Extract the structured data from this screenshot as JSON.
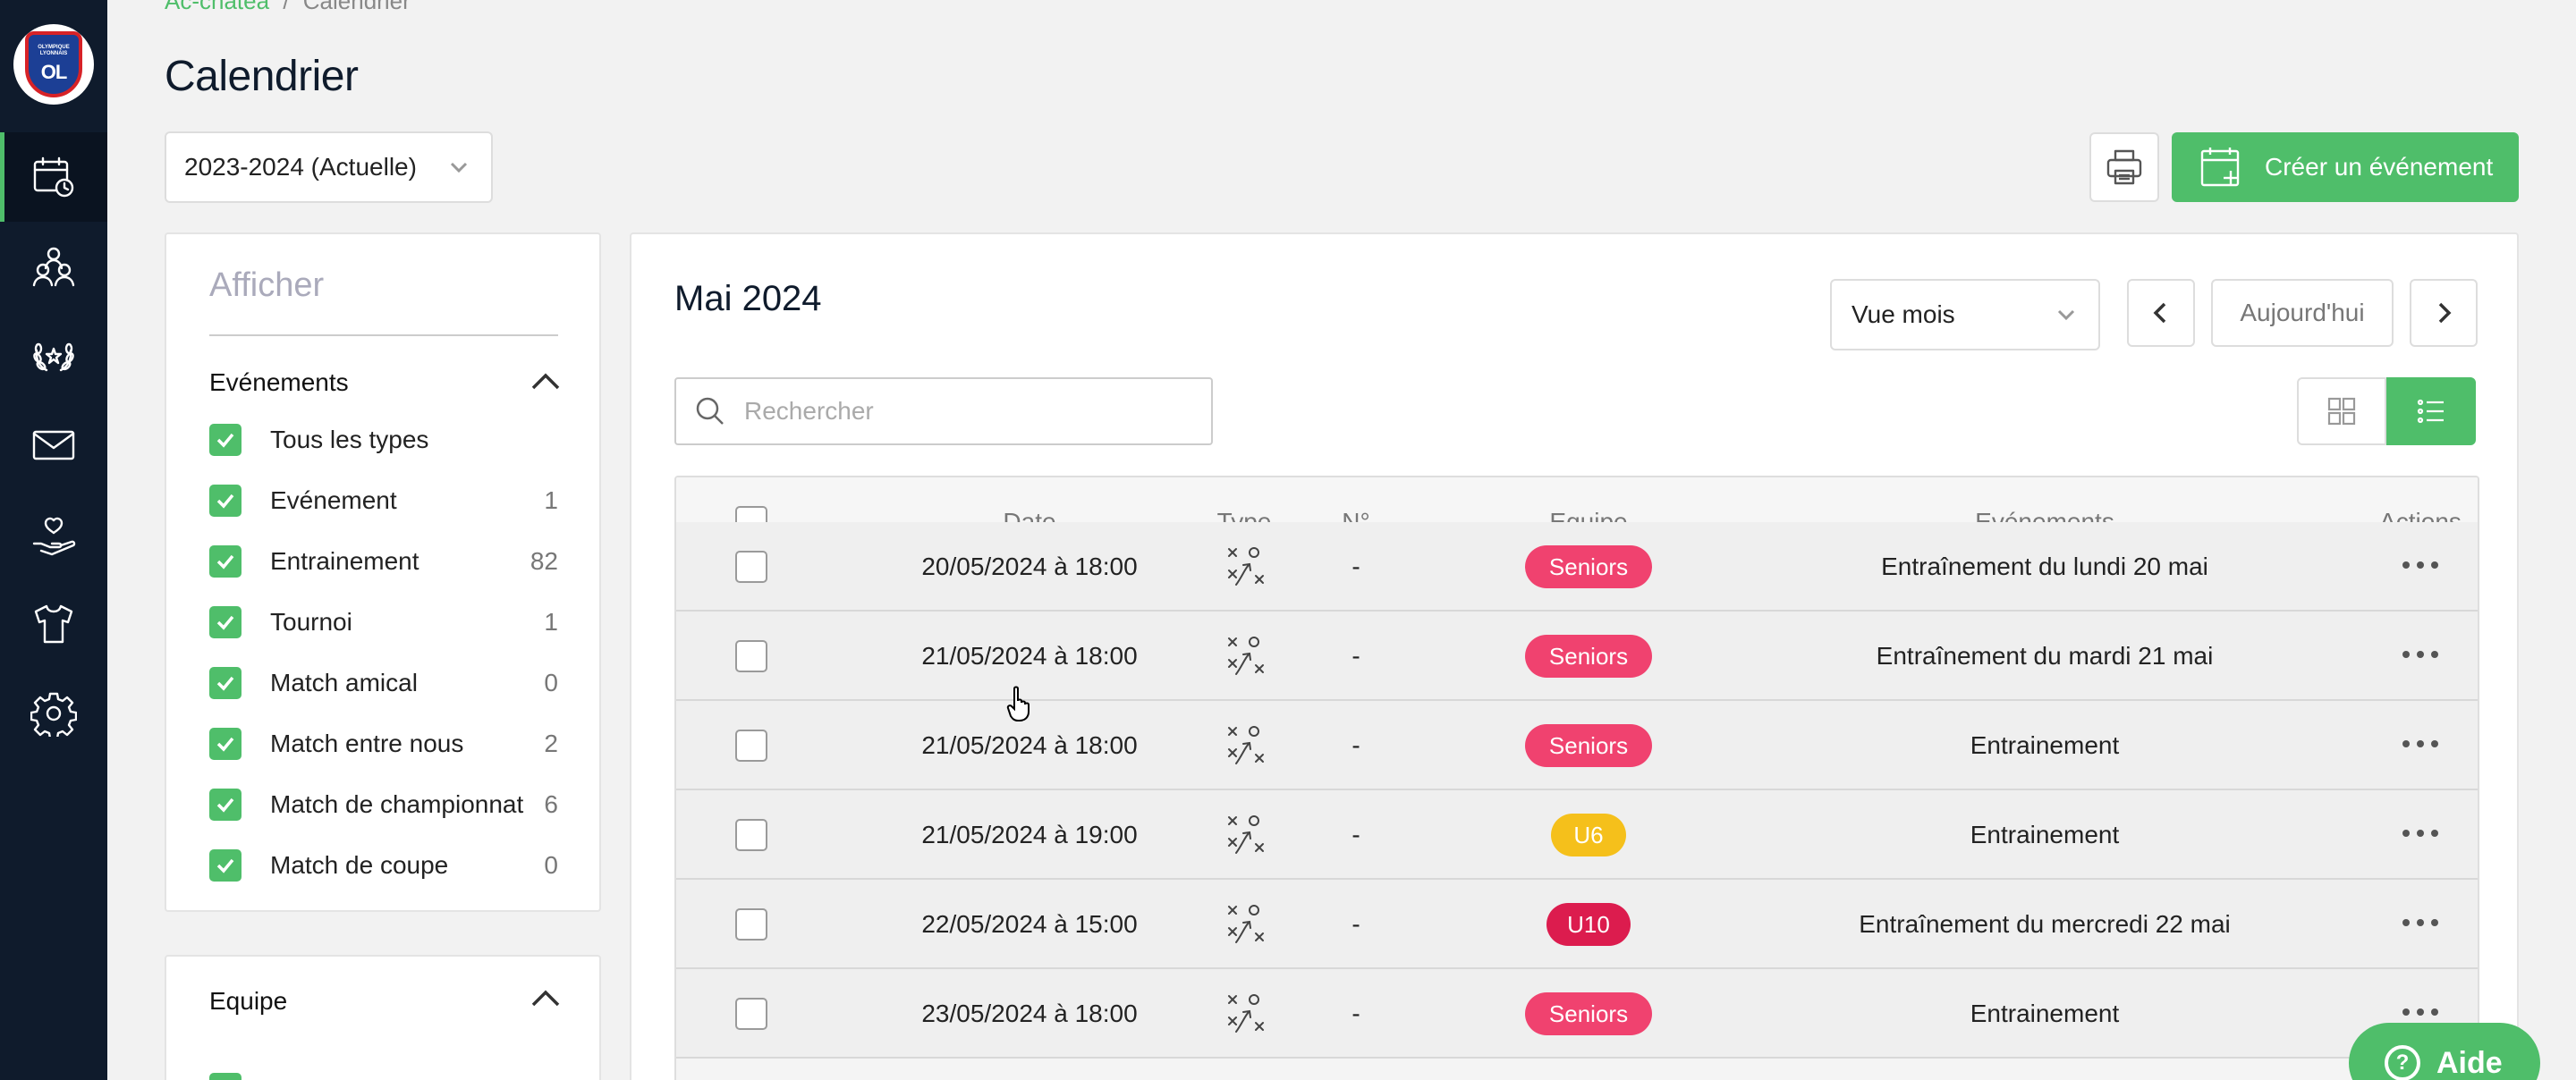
{
  "sidebar": {
    "logo_text": "OLYMPIQUE LYONNAIS",
    "logo_mark": "OL",
    "items": [
      {
        "icon": "calendar-clock-icon",
        "active": true
      },
      {
        "icon": "users-icon"
      },
      {
        "icon": "laurel-icon"
      },
      {
        "icon": "mail-icon"
      },
      {
        "icon": "hand-heart-icon"
      },
      {
        "icon": "jersey-icon"
      },
      {
        "icon": "gear-icon"
      }
    ]
  },
  "breadcrumb": {
    "link": "Ac-cnatea",
    "separator": "/",
    "current": "Calendrier"
  },
  "page_title": "Calendrier",
  "season_select": {
    "value": "2023-2024 (Actuelle)"
  },
  "toolbar": {
    "create_label": "Créer un événement"
  },
  "filters": {
    "title": "Afficher",
    "events_group": {
      "title": "Evénements",
      "items": [
        {
          "label": "Tous les types",
          "count": ""
        },
        {
          "label": "Evénement",
          "count": "1"
        },
        {
          "label": "Entrainement",
          "count": "82"
        },
        {
          "label": "Tournoi",
          "count": "1"
        },
        {
          "label": "Match amical",
          "count": "0"
        },
        {
          "label": "Match entre nous",
          "count": "2"
        },
        {
          "label": "Match de championnat",
          "count": "6"
        },
        {
          "label": "Match de coupe",
          "count": "0"
        }
      ]
    },
    "team_group": {
      "title": "Equipe"
    }
  },
  "calendar": {
    "month": "Mai 2024",
    "view_select": "Vue mois",
    "today_label": "Aujourd'hui",
    "search_placeholder": "Rechercher"
  },
  "table": {
    "columns": [
      "Date",
      "Type",
      "N°",
      "Equipe",
      "Evénements",
      "Actions"
    ],
    "rows": [
      {
        "date": "20/05/2024 à 18:00",
        "number": "-",
        "team": "Seniors",
        "team_color": "#f0426f",
        "event": "Entraînement du lundi 20 mai"
      },
      {
        "date": "21/05/2024 à 18:00",
        "number": "-",
        "team": "Seniors",
        "team_color": "#f0426f",
        "event": "Entraînement du mardi 21 mai"
      },
      {
        "date": "21/05/2024 à 18:00",
        "number": "-",
        "team": "Seniors",
        "team_color": "#f0426f",
        "event": "Entrainement"
      },
      {
        "date": "21/05/2024 à 19:00",
        "number": "-",
        "team": "U6",
        "team_color": "#f5c01b",
        "event": "Entrainement"
      },
      {
        "date": "22/05/2024 à 15:00",
        "number": "-",
        "team": "U10",
        "team_color": "#dc1c4e",
        "event": "Entraînement du mercredi 22 mai"
      },
      {
        "date": "23/05/2024 à 18:00",
        "number": "-",
        "team": "Seniors",
        "team_color": "#f0426f",
        "event": "Entrainement"
      }
    ]
  },
  "help": {
    "label": "Aide"
  },
  "colors": {
    "accent": "#4fbe6a",
    "sidebar": "#0f1b2c"
  }
}
